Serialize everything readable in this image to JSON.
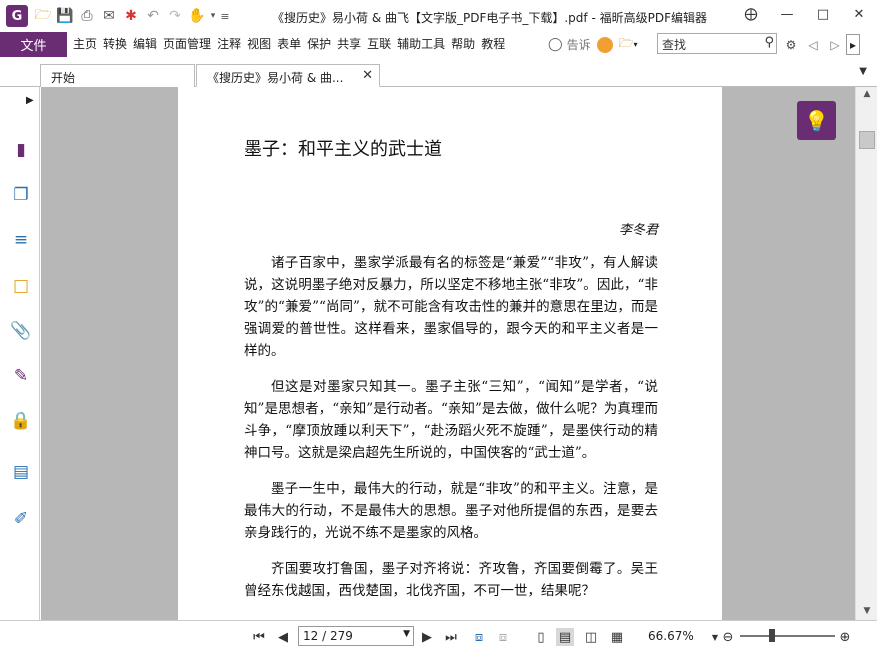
{
  "window": {
    "title": "《搜历史》易小荷 & 曲飞【文字版_PDF电子书_下载】.pdf - 福昕高级PDF编辑器",
    "logo_letter": "G"
  },
  "quick_access": [
    "open-folder-icon",
    "save-icon",
    "print-icon",
    "email-icon",
    "new-icon",
    "undo-icon",
    "redo-icon",
    "hand-tool-icon"
  ],
  "menu": {
    "file": "文件",
    "items": [
      "主页",
      "转换",
      "编辑",
      "页面管理",
      "注释",
      "视图",
      "表单",
      "保护",
      "共享",
      "互联",
      "辅助工具",
      "帮助",
      "教程"
    ],
    "tell_me": "告诉",
    "search_placeholder": "查找"
  },
  "tabs": {
    "home": "开始",
    "doc": "《搜历史》易小荷 & 曲..."
  },
  "document": {
    "title": "墨子：和平主义的武士道",
    "author": "李冬君",
    "paragraphs": [
      "诸子百家中，墨家学派最有名的标签是“兼爱”“非攻”，有人解读说，这说明墨子绝对反暴力，所以坚定不移地主张“非攻”。因此，“非攻”的“兼爱”“尚同”，就不可能含有攻击性的兼并的意思在里边，而是强调爱的普世性。这样看来，墨家倡导的，跟今天的和平主义者是一样的。",
      "但这是对墨家只知其一。墨子主张“三知”，“闻知”是学者，“说知”是思想者，“亲知”是行动者。“亲知”是去做，做什么呢？为真理而斗争，“摩顶放踵以利天下”，“赴汤蹈火死不旋踵”，是墨侠行动的精神口号。这就是梁启超先生所说的，中国侠客的“武士道”。",
      "墨子一生中，最伟大的行动，就是“非攻”的和平主义。注意，是最伟大的行动，不是最伟大的思想。墨子对他所提倡的东西，是要去亲身践行的，光说不练不是墨家的风格。",
      "齐国要攻打鲁国，墨子对齐将说：齐攻鲁，齐国要倒霉了。吴王曾经东伐越国，西伐楚国，北伐齐国，不可一世，结果呢？"
    ]
  },
  "statusbar": {
    "page_value": "12 / 279",
    "zoom": "66.67%",
    "zoom_level_fraction": 0.33
  },
  "colors": {
    "brand": "#6a2d73",
    "canvas_bg": "#b7b7b7",
    "tip_bulb": "#f7d24a"
  }
}
